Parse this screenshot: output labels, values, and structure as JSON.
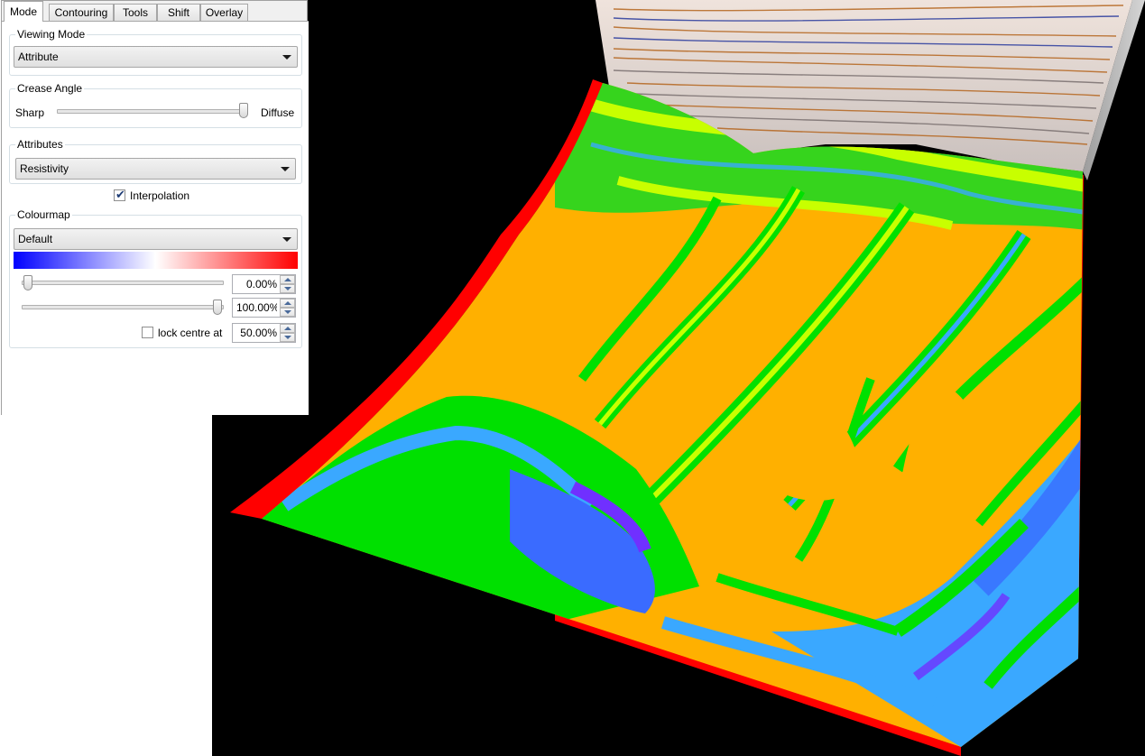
{
  "tabs": [
    {
      "label": "Mode",
      "active": true
    },
    {
      "label": "Contouring",
      "active": false
    },
    {
      "label": "Tools",
      "active": false
    },
    {
      "label": "Shift",
      "active": false
    },
    {
      "label": "Overlay",
      "active": false
    }
  ],
  "viewing_mode": {
    "title": "Viewing Mode",
    "value": "Attribute"
  },
  "crease_angle": {
    "title": "Crease Angle",
    "left_label": "Sharp",
    "right_label": "Diffuse",
    "level": 1.0
  },
  "attributes": {
    "title": "Attributes",
    "value": "Resistivity"
  },
  "interpolation": {
    "label": "Interpolation",
    "checked": true
  },
  "colourmap": {
    "title": "Colourmap",
    "value": "Default",
    "gradient_colors": [
      "#0000ff",
      "#ffffff",
      "#ff0000"
    ],
    "min_spin": "0.00%",
    "max_spin": "100.00%",
    "min_level": 0.0,
    "max_level": 1.0,
    "lock_label": "lock centre at",
    "lock_checked": false,
    "lock_spin": "50.00%"
  },
  "viewport": {
    "background": "#000000",
    "surface_colors": [
      "#ffb000",
      "#00e000",
      "#c8ff00",
      "#3aa8ff",
      "#7030ff",
      "#ff0000"
    ]
  }
}
